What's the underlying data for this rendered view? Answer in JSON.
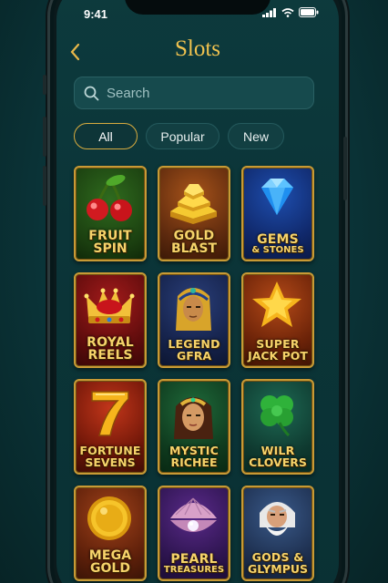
{
  "status": {
    "time": "9:41"
  },
  "header": {
    "title": "Slots"
  },
  "search": {
    "placeholder": "Search"
  },
  "filters": [
    {
      "label": "All",
      "active": true
    },
    {
      "label": "Popular"
    },
    {
      "label": "New"
    }
  ],
  "games": [
    {
      "line1": "FRUIT",
      "line2": "SPIN",
      "icon": "cherries-icon"
    },
    {
      "line1": "GOLD",
      "line2": "BLAST",
      "icon": "gold-bars-icon"
    },
    {
      "line1": "GEMS",
      "line2": "& STONES",
      "icon": "diamond-icon"
    },
    {
      "line1": "ROYAL",
      "line2": "REELS",
      "icon": "crown-icon"
    },
    {
      "line1": "LEGEND",
      "line2": "GFRA",
      "icon": "pharaoh-icon"
    },
    {
      "line1": "SUPER",
      "line2": "JACK POT",
      "icon": "star-icon"
    },
    {
      "line1": "FORTUNE",
      "line2": "SEVENS",
      "icon": "seven-icon"
    },
    {
      "line1": "MYSTIC",
      "line2": "RICHEE",
      "icon": "queen-icon"
    },
    {
      "line1": "WILR",
      "line2": "CLOVERS",
      "icon": "clover-icon"
    },
    {
      "line1": "MEGA",
      "line2": "GOLD",
      "icon": "gold-coin-icon"
    },
    {
      "line1": "PEARL",
      "line2": "TREASURES",
      "icon": "pearl-shell-icon"
    },
    {
      "line1": "GODS &",
      "line2": "GLYMPUS",
      "icon": "zeus-icon"
    }
  ]
}
